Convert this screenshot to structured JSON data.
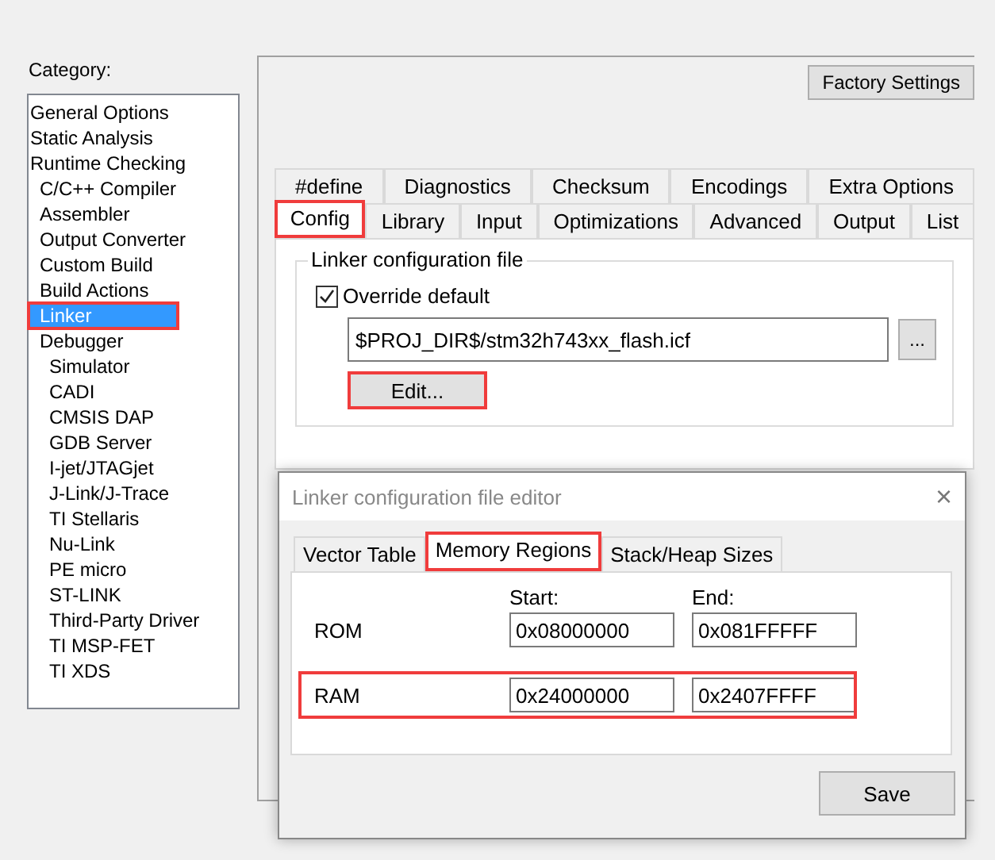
{
  "category": {
    "label": "Category:",
    "items": [
      {
        "label": "General Options",
        "selected": false,
        "highlighted": false
      },
      {
        "label": "Static Analysis",
        "selected": false,
        "highlighted": false
      },
      {
        "label": "Runtime Checking",
        "selected": false,
        "highlighted": false,
        "children": [
          {
            "label": "C/C++ Compiler",
            "selected": false,
            "highlighted": false
          },
          {
            "label": "Assembler",
            "selected": false,
            "highlighted": false
          },
          {
            "label": "Output Converter",
            "selected": false,
            "highlighted": false
          },
          {
            "label": "Custom Build",
            "selected": false,
            "highlighted": false
          },
          {
            "label": "Build Actions",
            "selected": false,
            "highlighted": false
          },
          {
            "label": "Linker",
            "selected": true,
            "highlighted": true
          },
          {
            "label": "Debugger",
            "selected": false,
            "highlighted": false,
            "children": [
              {
                "label": "Simulator",
                "selected": false,
                "highlighted": false
              },
              {
                "label": "CADI",
                "selected": false,
                "highlighted": false
              },
              {
                "label": "CMSIS DAP",
                "selected": false,
                "highlighted": false
              },
              {
                "label": "GDB Server",
                "selected": false,
                "highlighted": false
              },
              {
                "label": "I-jet/JTAGjet",
                "selected": false,
                "highlighted": false
              },
              {
                "label": "J-Link/J-Trace",
                "selected": false,
                "highlighted": false
              },
              {
                "label": "TI Stellaris",
                "selected": false,
                "highlighted": false
              },
              {
                "label": "Nu-Link",
                "selected": false,
                "highlighted": false
              },
              {
                "label": "PE micro",
                "selected": false,
                "highlighted": false
              },
              {
                "label": "ST-LINK",
                "selected": false,
                "highlighted": false
              },
              {
                "label": "Third-Party Driver",
                "selected": false,
                "highlighted": false
              },
              {
                "label": "TI MSP-FET",
                "selected": false,
                "highlighted": false
              },
              {
                "label": "TI XDS",
                "selected": false,
                "highlighted": false
              }
            ]
          }
        ]
      }
    ]
  },
  "factory_settings_button": "Factory Settings",
  "tab_rows": [
    [
      {
        "label": "#define",
        "selected": false,
        "highlighted": false
      },
      {
        "label": "Diagnostics",
        "selected": false,
        "highlighted": false
      },
      {
        "label": "Checksum",
        "selected": false,
        "highlighted": false
      },
      {
        "label": "Encodings",
        "selected": false,
        "highlighted": false
      },
      {
        "label": "Extra Options",
        "selected": false,
        "highlighted": false
      }
    ],
    [
      {
        "label": "Config",
        "selected": true,
        "highlighted": true
      },
      {
        "label": "Library",
        "selected": false,
        "highlighted": false
      },
      {
        "label": "Input",
        "selected": false,
        "highlighted": false
      },
      {
        "label": "Optimizations",
        "selected": false,
        "highlighted": false
      },
      {
        "label": "Advanced",
        "selected": false,
        "highlighted": false
      },
      {
        "label": "Output",
        "selected": false,
        "highlighted": false
      },
      {
        "label": "List",
        "selected": false,
        "highlighted": false
      }
    ]
  ],
  "config_group": {
    "title": "Linker configuration file",
    "override": {
      "label": "Override default",
      "checked": true
    },
    "path": "$PROJ_DIR$/stm32h743xx_flash.icf",
    "browse_button": "...",
    "edit_button": {
      "label": "Edit...",
      "highlighted": true
    }
  },
  "editor_dialog": {
    "title": "Linker configuration file editor",
    "close": "×",
    "tabs": [
      {
        "label": "Vector Table",
        "selected": false,
        "highlighted": false
      },
      {
        "label": "Memory Regions",
        "selected": true,
        "highlighted": true
      },
      {
        "label": "Stack/Heap Sizes",
        "selected": false,
        "highlighted": false
      }
    ],
    "columns": [
      "Start:",
      "End:"
    ],
    "regions": [
      {
        "name": "ROM",
        "start": "0x08000000",
        "end": "0x081FFFFF",
        "highlighted": false
      },
      {
        "name": "RAM",
        "start": "0x24000000",
        "end": "0x2407FFFF",
        "highlighted": true
      }
    ],
    "save_button": "Save"
  }
}
